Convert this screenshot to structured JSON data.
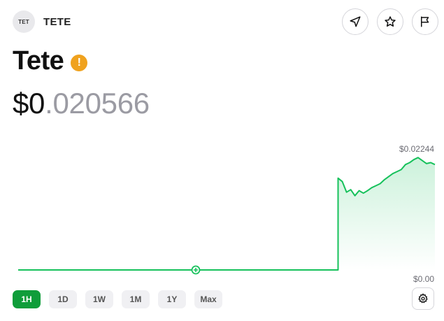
{
  "header": {
    "avatar_text": "TET",
    "ticker": "TETE",
    "actions": [
      {
        "name": "share",
        "icon": "send-arrow-icon"
      },
      {
        "name": "favorite",
        "icon": "star-icon"
      },
      {
        "name": "report",
        "icon": "flag-icon"
      }
    ]
  },
  "token": {
    "name": "Tete",
    "warning_icon": "warning-icon",
    "price_prefix": "$0",
    "price_suffix": ".020566"
  },
  "chart_data": {
    "type": "line",
    "title": "",
    "xlabel": "",
    "ylabel": "",
    "max_label": "$0.02244",
    "min_label": "$0.00",
    "ylim": [
      0,
      0.02244
    ],
    "x": [
      0,
      1,
      2,
      3,
      4,
      5,
      6,
      7,
      8,
      9,
      10,
      11,
      12,
      13,
      14,
      15,
      16,
      17,
      18,
      19,
      20,
      21,
      22,
      23,
      24,
      25,
      26,
      27,
      28,
      29,
      30,
      31,
      32,
      33,
      34,
      35,
      36,
      37,
      38,
      39,
      40,
      41,
      42,
      43,
      44,
      45,
      46,
      47,
      48,
      49,
      50,
      51,
      52,
      53,
      54,
      55,
      56,
      57,
      58,
      59,
      60,
      61,
      62,
      63,
      64,
      65,
      66,
      67,
      68,
      69,
      70,
      71,
      72,
      73,
      74,
      75,
      76,
      77,
      78,
      79,
      80,
      81,
      82,
      83,
      84,
      85,
      86,
      87,
      88,
      89,
      90,
      91,
      92,
      93,
      94,
      95,
      96,
      97,
      98,
      99
    ],
    "values": [
      0,
      0,
      0,
      0,
      0,
      0,
      0,
      0,
      0,
      0,
      0,
      0,
      0,
      0,
      0,
      0,
      0,
      0,
      0,
      0,
      0,
      0,
      0,
      0,
      0,
      0,
      0,
      0,
      0,
      0,
      0,
      0,
      0,
      0,
      0,
      0,
      0,
      0,
      0,
      0,
      0,
      0,
      0,
      0,
      0,
      0,
      0,
      0,
      0,
      0,
      0,
      0,
      0,
      0,
      0,
      0,
      0,
      0,
      0,
      0,
      0,
      0,
      0,
      0,
      0,
      0,
      0,
      0,
      0,
      0,
      0,
      0,
      0,
      0,
      0,
      0,
      0.0183,
      0.0176,
      0.0155,
      0.016,
      0.0148,
      0.0158,
      0.0153,
      0.0158,
      0.0164,
      0.0168,
      0.0172,
      0.018,
      0.0186,
      0.0192,
      0.0196,
      0.02,
      0.021,
      0.0214,
      0.022,
      0.0224,
      0.0218,
      0.0212,
      0.0214,
      0.021
    ],
    "line_color": "#16c15b",
    "fill_color": "#16c15b",
    "grid": false
  },
  "range": {
    "options": [
      "1H",
      "1D",
      "1W",
      "1M",
      "1Y",
      "Max"
    ],
    "selected": "1H",
    "settings_icon": "gear-icon"
  }
}
